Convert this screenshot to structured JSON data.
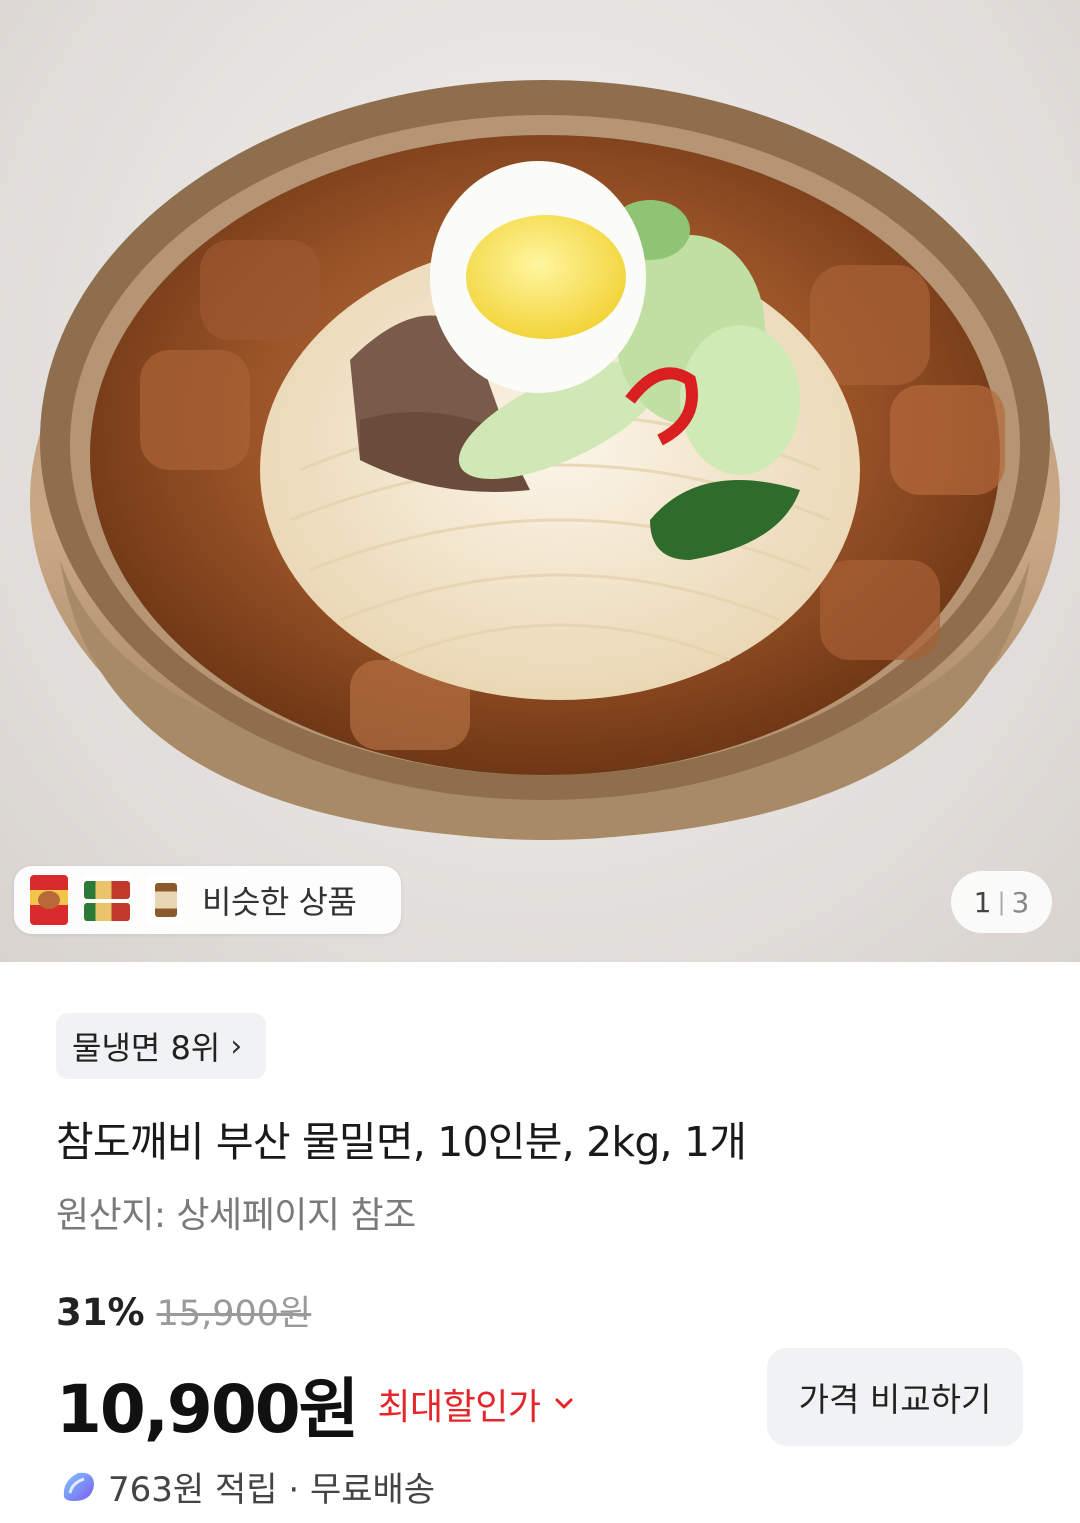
{
  "gallery": {
    "similar_label": "비슷한 상품",
    "similar_thumbs": [
      "naengmyeon-pack-red-icon",
      "naengmyeon-pack-multi-icon",
      "naengmyeon-pack-brown-icon"
    ],
    "page_current": "1",
    "page_total": "3"
  },
  "product": {
    "rank_label": "물냉면 8위",
    "title": "참도깨비 부산 물밀면, 10인분, 2kg, 1개",
    "origin": "원산지: 상세페이지 참조"
  },
  "price": {
    "discount_rate": "31%",
    "original_price": "15,900원",
    "sale_price": "10,900원",
    "max_discount_label": "최대할인가",
    "compare_button": "가격 비교하기"
  },
  "benefits": {
    "text": "763원 적립 · 무료배송"
  },
  "colors": {
    "accent_red": "#e5252a",
    "chip_bg": "#f1f2f4"
  }
}
